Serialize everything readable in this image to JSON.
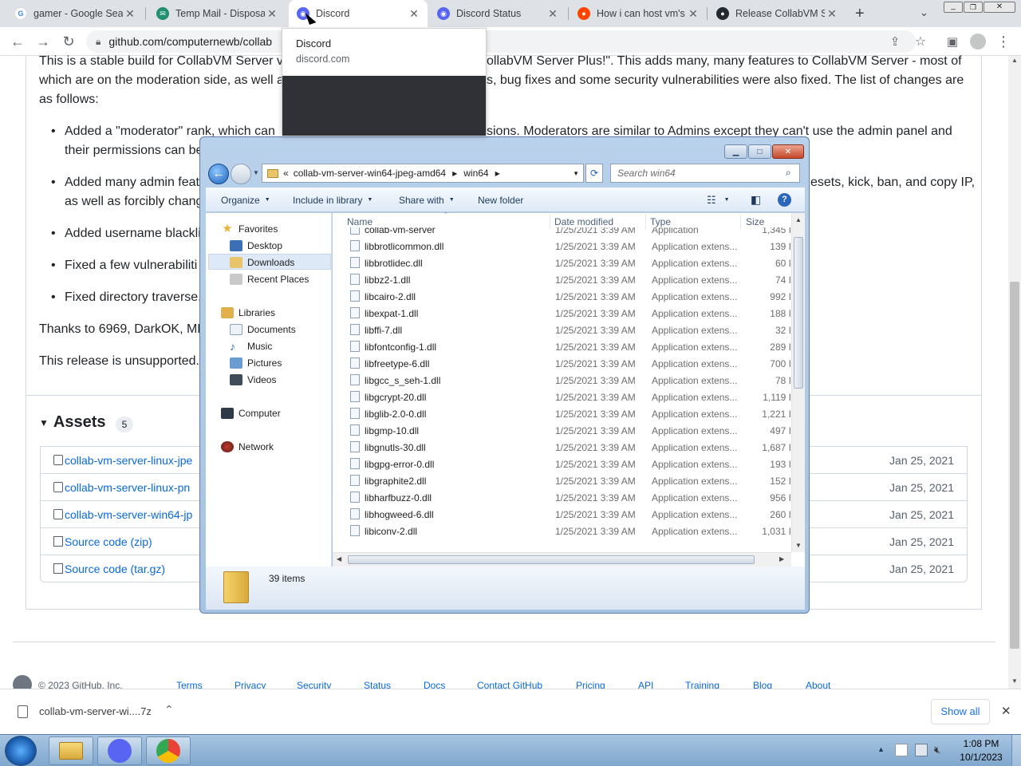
{
  "browser": {
    "tabs": [
      {
        "title": "gamer - Google Sear",
        "icon": "google-icon"
      },
      {
        "title": "Temp Mail - Disposal",
        "icon": "tempmail-icon"
      },
      {
        "title": "Discord",
        "icon": "discord-icon"
      },
      {
        "title": "Discord Status",
        "icon": "discord-icon"
      },
      {
        "title": "How i can host vm's",
        "icon": "reddit-icon"
      },
      {
        "title": "Release CollabVM Se",
        "icon": "github-icon"
      }
    ],
    "url": "github.com/computernewb/collab",
    "tooltip": {
      "title": "Discord",
      "subtitle": "discord.com"
    }
  },
  "page": {
    "intro_line1": "This is a stable build for CollabVM Server v",
    "intro_line1b": "ollabVM Server Plus!\". This adds many, many features to CollabVM Server - most of",
    "intro_line2": "which are on the moderation side, as well a",
    "intro_line2b": "s, bug fixes and some security vulnerabilities were also fixed. The list of changes are",
    "intro_line3": "as follows:",
    "bullets": [
      {
        "a": "Added a \"moderator\" rank, which can",
        "b": "sions. Moderators are similar to Admins except they can't use the admin panel and",
        "c": "their permissions can be"
      },
      {
        "a": "Added many admin feat",
        "b": "esets, kick, ban, and copy IP,",
        "c": "as well as forcibly chang"
      },
      {
        "a": "Added username blackli",
        "b": "",
        "c": ""
      },
      {
        "a": "Fixed a few vulnerabiliti",
        "b": "",
        "c": ""
      },
      {
        "a": "Fixed directory traverse.",
        "b": "",
        "c": ""
      }
    ],
    "thanks": "Thanks to 6969, DarkOK, MD",
    "unsupported": "This release is unsupported.",
    "assets_title": "Assets",
    "assets_count": "5",
    "assets": [
      {
        "name": "collab-vm-server-linux-jpe",
        "date": "Jan 25, 2021"
      },
      {
        "name": "collab-vm-server-linux-pn",
        "date": "Jan 25, 2021"
      },
      {
        "name": "collab-vm-server-win64-jp",
        "date": "Jan 25, 2021"
      },
      {
        "name": "Source code (zip)",
        "date": "Jan 25, 2021"
      },
      {
        "name": "Source code (tar.gz)",
        "date": "Jan 25, 2021"
      }
    ],
    "footer": {
      "copyright": "© 2023 GitHub, Inc.",
      "links": [
        "Terms",
        "Privacy",
        "Security",
        "Status",
        "Docs",
        "Contact GitHub",
        "Pricing",
        "API",
        "Training",
        "Blog",
        "About"
      ]
    }
  },
  "download": {
    "filename": "collab-vm-server-wi....7z",
    "show_all": "Show all"
  },
  "explorer": {
    "breadcrumb": [
      "collab-vm-server-win64-jpeg-amd64",
      "win64"
    ],
    "search_placeholder": "Search win64",
    "commands": [
      "Organize",
      "Include in library",
      "Share with",
      "New folder"
    ],
    "nav": {
      "favorites": "Favorites",
      "fav_items": [
        "Desktop",
        "Downloads",
        "Recent Places"
      ],
      "libraries": "Libraries",
      "lib_items": [
        "Documents",
        "Music",
        "Pictures",
        "Videos"
      ],
      "computer": "Computer",
      "network": "Network"
    },
    "columns": [
      "Name",
      "Date modified",
      "Type",
      "Size"
    ],
    "files": [
      {
        "name": "collab-vm-server",
        "date": "1/25/2021 3:39 AM",
        "type": "Application",
        "size": "1,345 I"
      },
      {
        "name": "libbrotlicommon.dll",
        "date": "1/25/2021 3:39 AM",
        "type": "Application extens...",
        "size": "139 I"
      },
      {
        "name": "libbrotlidec.dll",
        "date": "1/25/2021 3:39 AM",
        "type": "Application extens...",
        "size": "60 I"
      },
      {
        "name": "libbz2-1.dll",
        "date": "1/25/2021 3:39 AM",
        "type": "Application extens...",
        "size": "74 I"
      },
      {
        "name": "libcairo-2.dll",
        "date": "1/25/2021 3:39 AM",
        "type": "Application extens...",
        "size": "992 I"
      },
      {
        "name": "libexpat-1.dll",
        "date": "1/25/2021 3:39 AM",
        "type": "Application extens...",
        "size": "188 I"
      },
      {
        "name": "libffi-7.dll",
        "date": "1/25/2021 3:39 AM",
        "type": "Application extens...",
        "size": "32 I"
      },
      {
        "name": "libfontconfig-1.dll",
        "date": "1/25/2021 3:39 AM",
        "type": "Application extens...",
        "size": "289 I"
      },
      {
        "name": "libfreetype-6.dll",
        "date": "1/25/2021 3:39 AM",
        "type": "Application extens...",
        "size": "700 I"
      },
      {
        "name": "libgcc_s_seh-1.dll",
        "date": "1/25/2021 3:39 AM",
        "type": "Application extens...",
        "size": "78 I"
      },
      {
        "name": "libgcrypt-20.dll",
        "date": "1/25/2021 3:39 AM",
        "type": "Application extens...",
        "size": "1,119 I"
      },
      {
        "name": "libglib-2.0-0.dll",
        "date": "1/25/2021 3:39 AM",
        "type": "Application extens...",
        "size": "1,221 I"
      },
      {
        "name": "libgmp-10.dll",
        "date": "1/25/2021 3:39 AM",
        "type": "Application extens...",
        "size": "497 I"
      },
      {
        "name": "libgnutls-30.dll",
        "date": "1/25/2021 3:39 AM",
        "type": "Application extens...",
        "size": "1,687 I"
      },
      {
        "name": "libgpg-error-0.dll",
        "date": "1/25/2021 3:39 AM",
        "type": "Application extens...",
        "size": "193 I"
      },
      {
        "name": "libgraphite2.dll",
        "date": "1/25/2021 3:39 AM",
        "type": "Application extens...",
        "size": "152 I"
      },
      {
        "name": "libharfbuzz-0.dll",
        "date": "1/25/2021 3:39 AM",
        "type": "Application extens...",
        "size": "956 I"
      },
      {
        "name": "libhogweed-6.dll",
        "date": "1/25/2021 3:39 AM",
        "type": "Application extens...",
        "size": "260 I"
      },
      {
        "name": "libiconv-2.dll",
        "date": "1/25/2021 3:39 AM",
        "type": "Application extens...",
        "size": "1,031 I"
      }
    ],
    "item_count": "39 items"
  },
  "taskbar": {
    "time": "1:08 PM",
    "date": "10/1/2023"
  },
  "colors": {
    "link": "#0969da",
    "discord": "#5865f2"
  }
}
